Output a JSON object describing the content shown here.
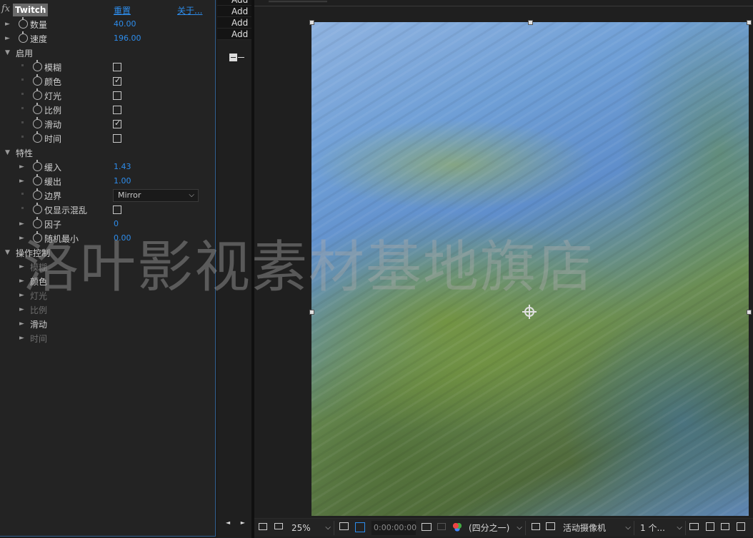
{
  "effects": {
    "fx_icon": "fx",
    "effect_name": "Twitch",
    "reset_link": "重置",
    "about_link": "关于...",
    "rows": [
      {
        "kind": "param",
        "twirl": "►",
        "label": "数量",
        "value": "40.00"
      },
      {
        "kind": "param",
        "twirl": "►",
        "label": "速度",
        "value": "196.00"
      },
      {
        "kind": "group",
        "twirl": "▼",
        "label": "启用"
      },
      {
        "kind": "check",
        "label": "模糊",
        "checked": false
      },
      {
        "kind": "check",
        "label": "颜色",
        "checked": true
      },
      {
        "kind": "check",
        "label": "灯光",
        "checked": false
      },
      {
        "kind": "check",
        "label": "比例",
        "checked": false
      },
      {
        "kind": "check",
        "label": "滑动",
        "checked": true
      },
      {
        "kind": "check",
        "label": "时间",
        "checked": false
      },
      {
        "kind": "group",
        "twirl": "▼",
        "label": "特性"
      },
      {
        "kind": "subparam",
        "twirl": "►",
        "label": "缓入",
        "value": "1.43"
      },
      {
        "kind": "subparam",
        "twirl": "►",
        "label": "缓出",
        "value": "1.00"
      },
      {
        "kind": "select",
        "label": "边界",
        "value": "Mirror"
      },
      {
        "kind": "check",
        "label": "仅显示混乱",
        "checked": false
      },
      {
        "kind": "subparam",
        "twirl": "►",
        "label": "因子",
        "value": "0"
      },
      {
        "kind": "subparam",
        "twirl": "►",
        "label": "随机最小",
        "value": "0.00"
      },
      {
        "kind": "group",
        "twirl": "▼",
        "label": "操作控制"
      },
      {
        "kind": "sub",
        "twirl": "►",
        "label": "模糊",
        "dim": true
      },
      {
        "kind": "sub",
        "twirl": "►",
        "label": "颜色",
        "dim": false
      },
      {
        "kind": "sub",
        "twirl": "►",
        "label": "灯光",
        "dim": true
      },
      {
        "kind": "sub",
        "twirl": "►",
        "label": "比例",
        "dim": true
      },
      {
        "kind": "sub",
        "twirl": "►",
        "label": "滑动",
        "dim": false
      },
      {
        "kind": "sub",
        "twirl": "►",
        "label": "时间",
        "dim": true
      }
    ]
  },
  "middle": {
    "add_buttons": [
      "Add",
      "Add",
      "Add",
      "Add"
    ],
    "nav_arrows": "◄ ►"
  },
  "viewer": {
    "watermark": "洛叶影视素材基地旗店"
  },
  "toolbar": {
    "zoom": "25%",
    "timecode": "0:00:00:00",
    "resolution": "(四分之一)",
    "camera": "活动摄像机",
    "views": "1 个..."
  }
}
